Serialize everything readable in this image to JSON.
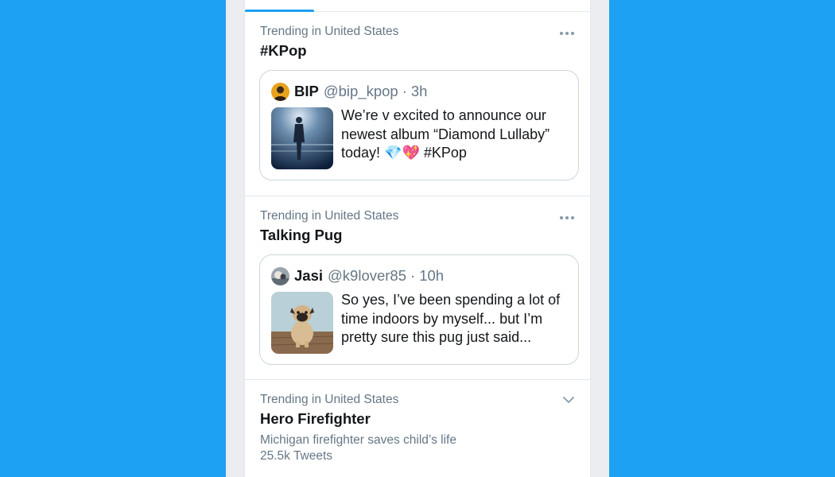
{
  "colors": {
    "background": "#1da1f2",
    "accent": "#1da1f2",
    "secondary_text": "#657786",
    "primary_text": "#14171a"
  },
  "trends": [
    {
      "meta": "Trending in United States",
      "title": "#KPop",
      "menu_icon": "more-dots-icon",
      "tweet": {
        "name": "BIP",
        "handle": "@bip_kpop",
        "separator": "·",
        "time": "3h",
        "text": "We’re v excited to announce our\nnewest album “Diamond Lullaby”\ntoday! 💎💖 #KPop",
        "avatar_icon": "bip-avatar",
        "image": "concert-performer-image"
      }
    },
    {
      "meta": "Trending in United States",
      "title": "Talking Pug",
      "menu_icon": "more-dots-icon",
      "tweet": {
        "name": "Jasi",
        "handle": "@k9lover85",
        "separator": "·",
        "time": "10h",
        "text": "So yes, I’ve been spending a lot of\ntime indoors by myself... but I’m\npretty sure this pug just said...",
        "avatar_icon": "jasi-avatar",
        "image": "pug-on-deck-image"
      }
    },
    {
      "meta": "Trending in United States",
      "title": "Hero Firefighter",
      "menu_icon": "chevron-down-icon",
      "description": "Michigan firefighter saves child’s life",
      "count": "25.5k Tweets"
    }
  ]
}
